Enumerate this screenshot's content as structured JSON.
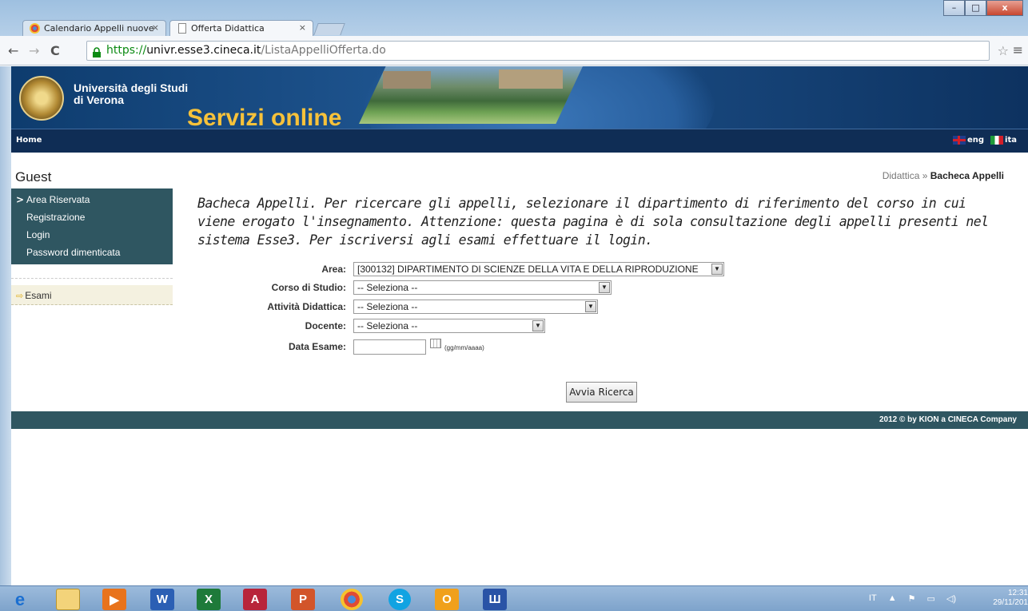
{
  "browser": {
    "tabs": [
      {
        "title": "Calendario Appelli nuove",
        "close": "×"
      },
      {
        "title": "Offerta Didattica",
        "close": "×"
      }
    ],
    "url_https": "https://",
    "url_domain": "univr.esse3.cineca.it",
    "url_path": "/ListaAppelliOfferta.do",
    "back": "←",
    "forward": "→",
    "reload": "C",
    "star": "☆",
    "menu": "≡",
    "win_min": "–",
    "win_max": "□",
    "win_close": "x"
  },
  "header": {
    "uni_line1": "Università degli Studi",
    "uni_line2": "di Verona",
    "servizi": "Servizi online"
  },
  "navbar": {
    "home": "Home",
    "lang_eng": "eng",
    "lang_ita": "ita"
  },
  "sidebar": {
    "user": "Guest",
    "chevron": ">",
    "items": [
      {
        "label": "Area Riservata"
      },
      {
        "label": "Registrazione"
      },
      {
        "label": "Login"
      },
      {
        "label": "Password dimenticata"
      }
    ],
    "esami_arrow": "⇨",
    "esami": "Esami"
  },
  "breadcrumb": {
    "parent": "Didattica",
    "sep": " » ",
    "current": "Bacheca Appelli"
  },
  "intro": "Bacheca Appelli. Per ricercare gli appelli, selezionare il dipartimento di riferimento del corso in cui viene erogato l'insegnamento. Attenzione: questa pagina è di sola consultazione degli appelli presenti nel sistema Esse3. Per iscriversi agli esami effettuare il login.",
  "form": {
    "area_label": "Area:",
    "area_value": "[300132] DIPARTIMENTO DI SCIENZE DELLA VITA E DELLA RIPRODUZIONE",
    "corso_label": "Corso di Studio:",
    "corso_value": "-- Seleziona --",
    "attivita_label": "Attività Didattica:",
    "attivita_value": "-- Seleziona --",
    "docente_label": "Docente:",
    "docente_value": "-- Seleziona --",
    "data_label": "Data Esame:",
    "data_value": "",
    "data_hint": "(gg/mm/aaaa)",
    "dropdown_arrow": "▼",
    "search_button": "Avvia Ricerca"
  },
  "footer": {
    "text": "2012 © by KION a CINECA Company"
  },
  "taskbar": {
    "lang": "IT",
    "tray_up": "▲",
    "tray_flag": "⚑",
    "tray_net": "▭",
    "tray_vol": "◁)",
    "time": "12:31",
    "date": "29/11/201"
  }
}
